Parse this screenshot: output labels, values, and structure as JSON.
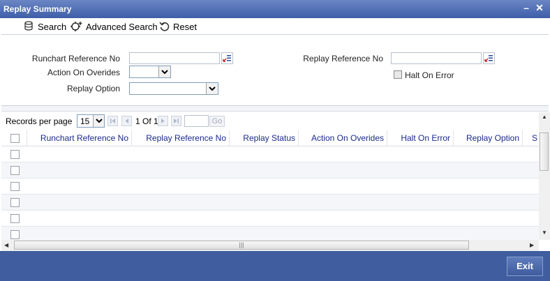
{
  "window": {
    "title": "Replay Summary"
  },
  "toolbar": {
    "search_label": "Search",
    "advanced_search_label": "Advanced Search",
    "reset_label": "Reset"
  },
  "form": {
    "runchart_ref_label": "Runchart Reference No",
    "runchart_ref_value": "",
    "replay_ref_label": "Replay Reference No",
    "replay_ref_value": "",
    "action_on_overides_label": "Action On Overides",
    "action_on_overides_value": "",
    "halt_on_error_label": "Halt On Error",
    "halt_on_error_checked": false,
    "replay_option_label": "Replay Option",
    "replay_option_value": ""
  },
  "pager": {
    "records_per_page_label": "Records per page",
    "records_per_page_value": "15",
    "page_info": "1 Of 1",
    "go_label": "Go"
  },
  "grid": {
    "columns": [
      "Runchart Reference No",
      "Replay Reference No",
      "Replay Status",
      "Action On Overides",
      "Halt On Error",
      "Replay Option",
      "S"
    ],
    "row_count": 7
  },
  "footer": {
    "exit_label": "Exit"
  },
  "colors": {
    "titlebar": "#3e5ea9",
    "footer": "#3f5d9f",
    "header_text": "#1a2a8a"
  }
}
